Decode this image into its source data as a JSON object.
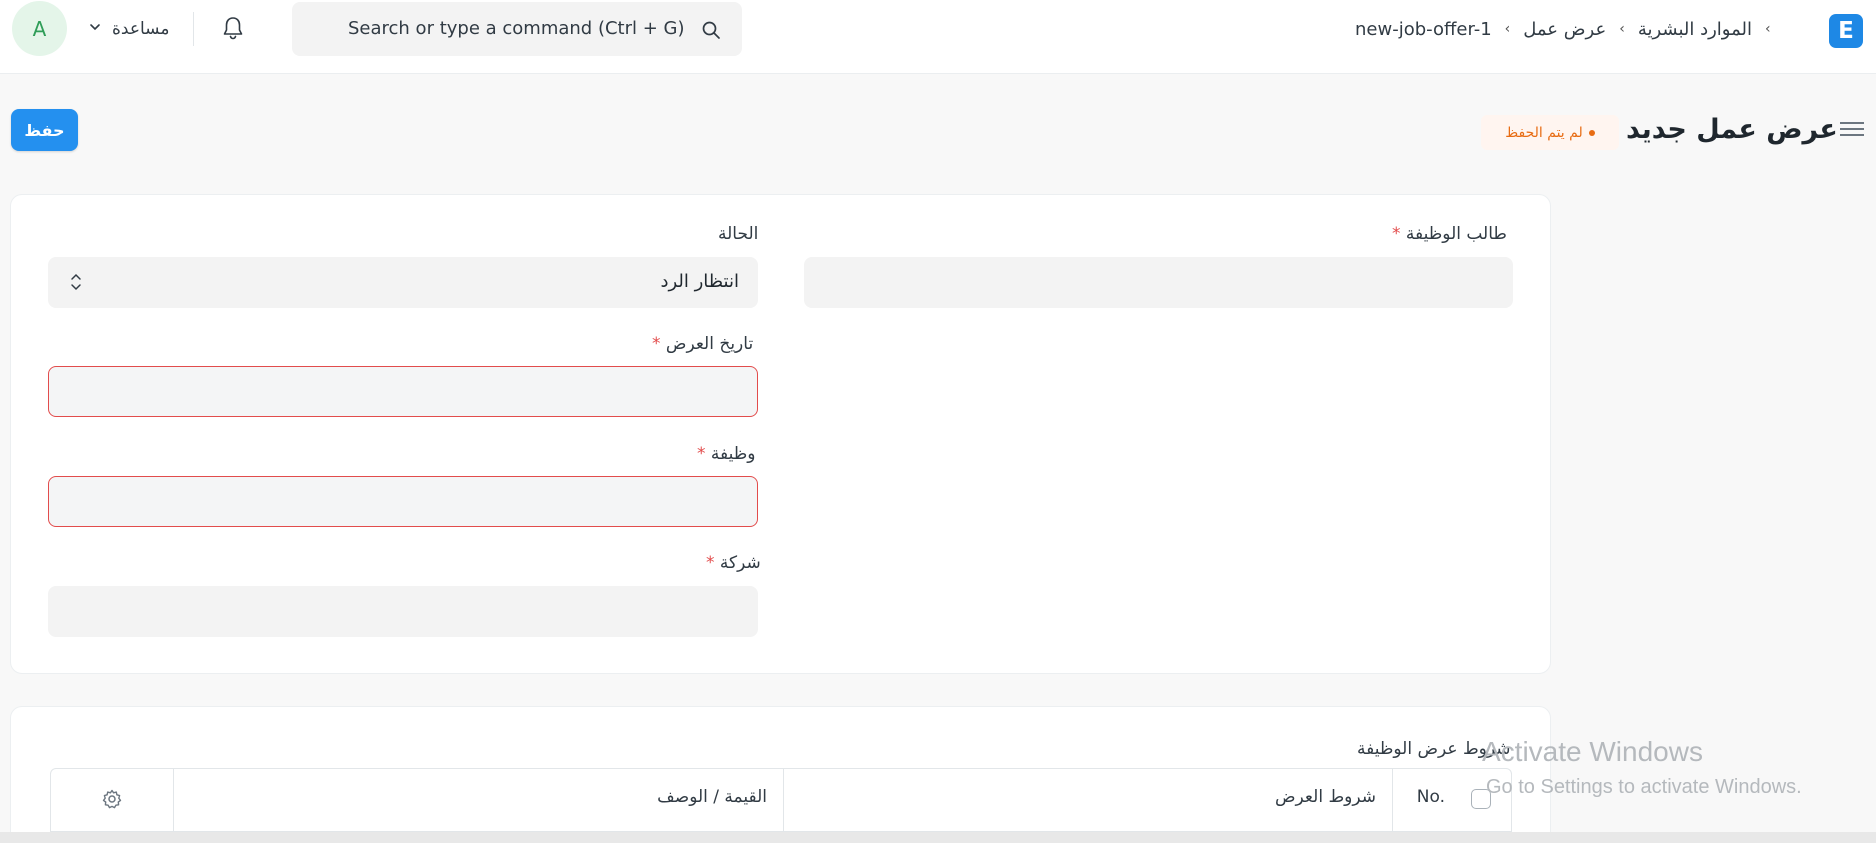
{
  "navbar": {
    "avatar_initial": "A",
    "help_label": "مساعدة",
    "search_placeholder": "Search or type a command (Ctrl + G)",
    "breadcrumbs": [
      "الموارد البشرية",
      "عرض عمل",
      "new-job-offer-1"
    ],
    "logo_letter": "E"
  },
  "page": {
    "title": "عرض عمل جديد",
    "status_badge": "لم يتم الحفظ",
    "save_label": "حفظ"
  },
  "form": {
    "job_applicant": {
      "label": "طالب الوظيفة",
      "value": ""
    },
    "status": {
      "label": "الحالة",
      "value": "انتظار الرد"
    },
    "offer_date": {
      "label": "تاريخ العرض",
      "value": ""
    },
    "designation": {
      "label": "وظيفة",
      "value": ""
    },
    "company": {
      "label": "شركة",
      "value": ""
    },
    "required_mark": "*"
  },
  "terms_table": {
    "label": "شروط عرض الوظيفة",
    "columns": [
      "No.",
      "شروط العرض",
      "القيمة / الوصف"
    ]
  },
  "overlay": {
    "watermark_title": "Activate Windows",
    "watermark_subtitle": "Go to Settings to activate Windows."
  },
  "colors": {
    "primary": "#2490ef",
    "error_border": "#e24c4c",
    "badge_text": "#e86c13"
  }
}
